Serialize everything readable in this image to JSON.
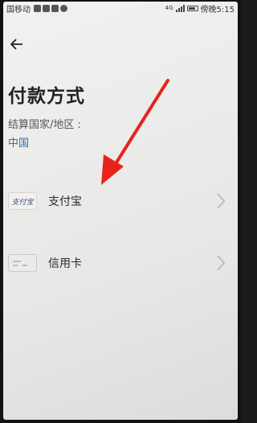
{
  "status_bar": {
    "carrier": "国移动",
    "time": "傍晚5:15",
    "network": "4G"
  },
  "header": {
    "back_icon": "back-arrow-icon",
    "title": "付款方式"
  },
  "region": {
    "label": "结算国家/地区 :",
    "value": "中国"
  },
  "payment_methods": [
    {
      "label": "支付宝",
      "logo_text": "支付宝",
      "icon": "alipay-logo"
    },
    {
      "label": "信用卡",
      "icon": "credit-card-icon"
    }
  ],
  "annotation": {
    "color": "#e8231c",
    "icon": "red-pointer-arrow"
  },
  "colors": {
    "accent_link": "#3a6f9c",
    "title": "#222222"
  }
}
